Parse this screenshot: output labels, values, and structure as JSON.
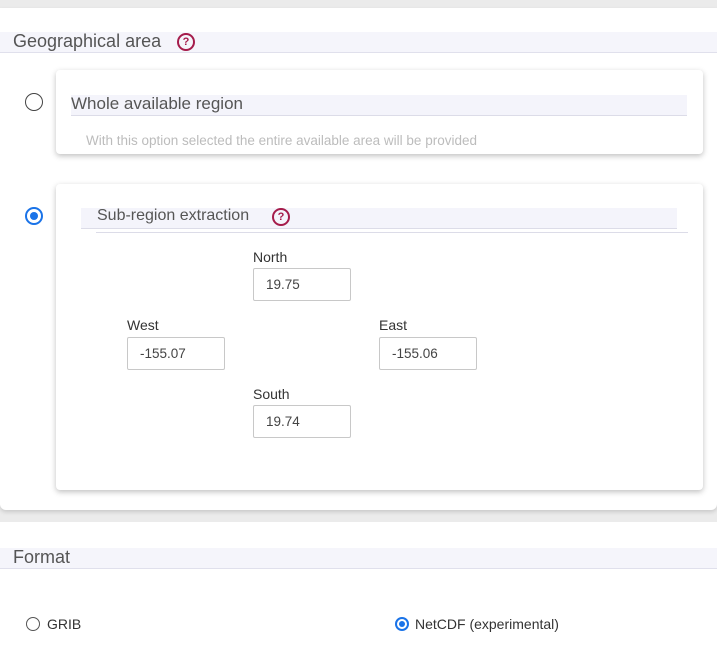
{
  "geo": {
    "heading": "Geographical area",
    "help_glyph": "?",
    "whole": {
      "title": "Whole available region",
      "description": "With this option selected the entire available area will be provided",
      "selected": false
    },
    "subregion": {
      "title": "Sub-region extraction",
      "help_glyph": "?",
      "selected": true,
      "north": {
        "label": "North",
        "value": "19.75"
      },
      "west": {
        "label": "West",
        "value": "-155.07"
      },
      "east": {
        "label": "East",
        "value": "-155.06"
      },
      "south": {
        "label": "South",
        "value": "19.74"
      }
    }
  },
  "format": {
    "heading": "Format",
    "options": [
      {
        "label": "GRIB",
        "selected": false
      },
      {
        "label": "NetCDF (experimental)",
        "selected": true
      }
    ]
  },
  "colors": {
    "accent": "#1a73e8",
    "help": "#a51c4b"
  }
}
